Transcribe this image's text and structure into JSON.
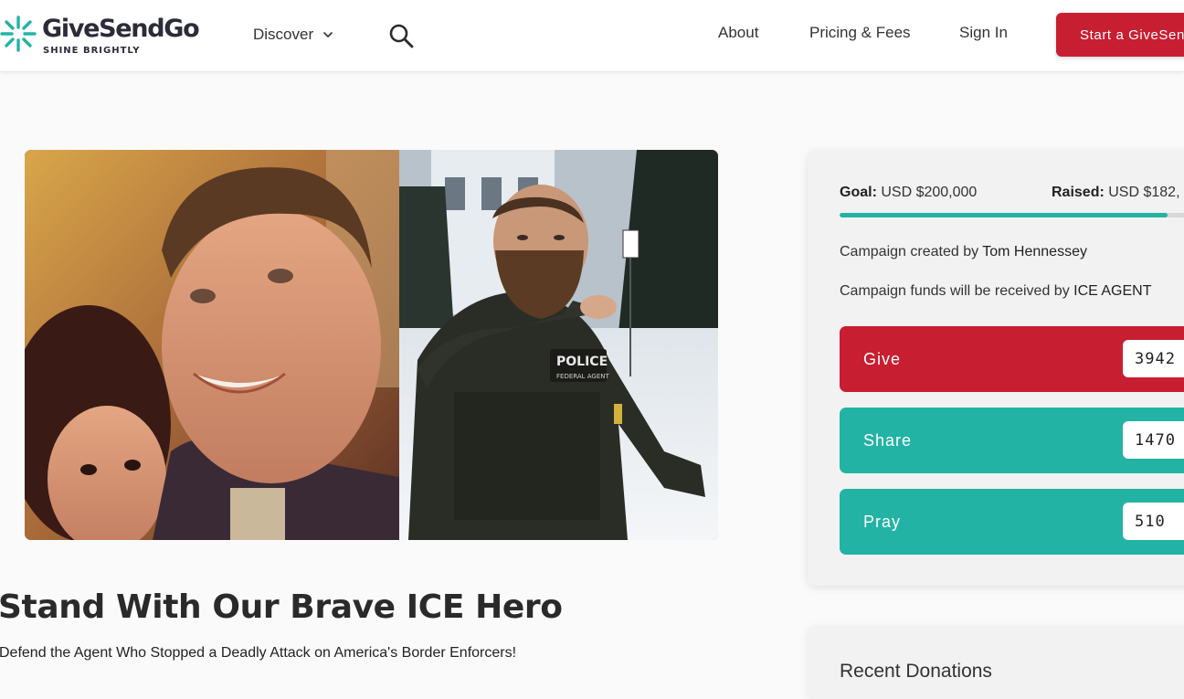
{
  "header": {
    "brand": "GiveSendGo",
    "tagline": "SHINE BRIGHTLY",
    "nav": {
      "discover": "Discover",
      "about": "About",
      "pricing": "Pricing & Fees",
      "signin": "Sign In",
      "start": "Start a GiveSendGo"
    }
  },
  "campaign": {
    "title": "Stand With Our Brave ICE Hero",
    "subtitle": "Defend the Agent Who Stopped a Deadly Attack on America's Border Enforcers!",
    "patch_text": "POLICE",
    "patch_subtext": "FEDERAL AGENT"
  },
  "sidebar": {
    "goal_label": "Goal:",
    "goal_value": "USD $200,000",
    "raised_label": "Raised:",
    "raised_value": "USD $182,",
    "progress_fraction": 0.91,
    "created_prefix": "Campaign created by",
    "created_by": "Tom Hennessey",
    "funds_prefix": "Campaign funds will be received by",
    "funds_receiver": "ICE AGENT",
    "actions": [
      {
        "label": "Give",
        "count": "3942"
      },
      {
        "label": "Share",
        "count": "1470"
      },
      {
        "label": "Pray",
        "count": "510"
      }
    ],
    "recent_title": "Recent Donations"
  },
  "colors": {
    "brand_red": "#c81e31",
    "teal": "#23b3a4",
    "text": "#222222"
  },
  "icons": {
    "logo": "starburst-logo-icon",
    "discover": "chevron-down-icon",
    "search": "search-icon"
  }
}
